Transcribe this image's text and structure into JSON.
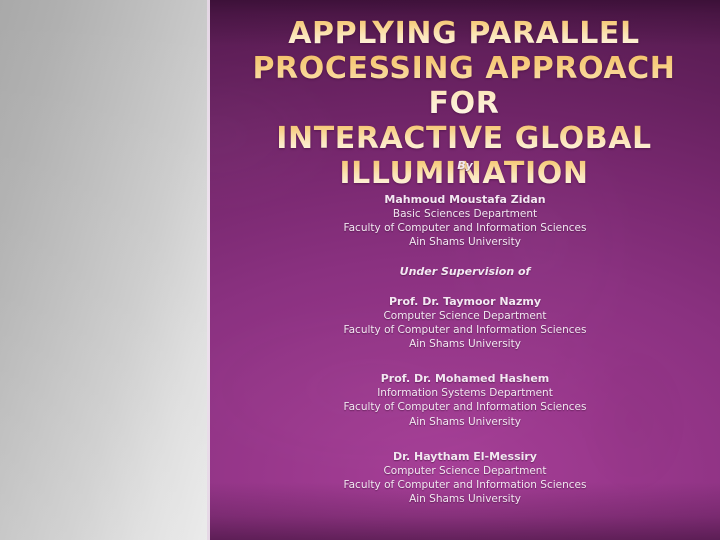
{
  "slide": {
    "title_lines": [
      "Applying Parallel",
      "Processing Approach for",
      "Interactive Global",
      "Illumination"
    ],
    "by_label": "By",
    "author": {
      "name": "Mahmoud Moustafa Zidan",
      "department": "Basic Sciences Department",
      "faculty": "Faculty of Computer and Information Sciences",
      "university": "Ain Shams University"
    },
    "supervision_label": "Under Supervision of",
    "supervisors": [
      {
        "name": "Prof. Dr. Taymoor Nazmy",
        "department": "Computer Science Department",
        "faculty": "Faculty of Computer and Information Sciences",
        "university": "Ain Shams University"
      },
      {
        "name": "Prof. Dr. Mohamed Hashem",
        "department": "Information Systems Department",
        "faculty": "Faculty of Computer and Information Sciences",
        "university": "Ain Shams University"
      },
      {
        "name": "Dr. Haytham El-Messiry",
        "department": "Computer Science Department",
        "faculty": "Faculty of Computer and Information Sciences",
        "university": "Ain Shams University"
      }
    ],
    "colors": {
      "title_gold": "#f2be63",
      "title_cream": "#fffaf0",
      "body_text": "#f3e8f2",
      "background_purple_light": "#a63f97",
      "background_purple_dark": "#521a4c",
      "left_panel_light": "#e7e7e7",
      "left_panel_dark": "#a9a9a9",
      "divider": "#efe3ef"
    }
  }
}
